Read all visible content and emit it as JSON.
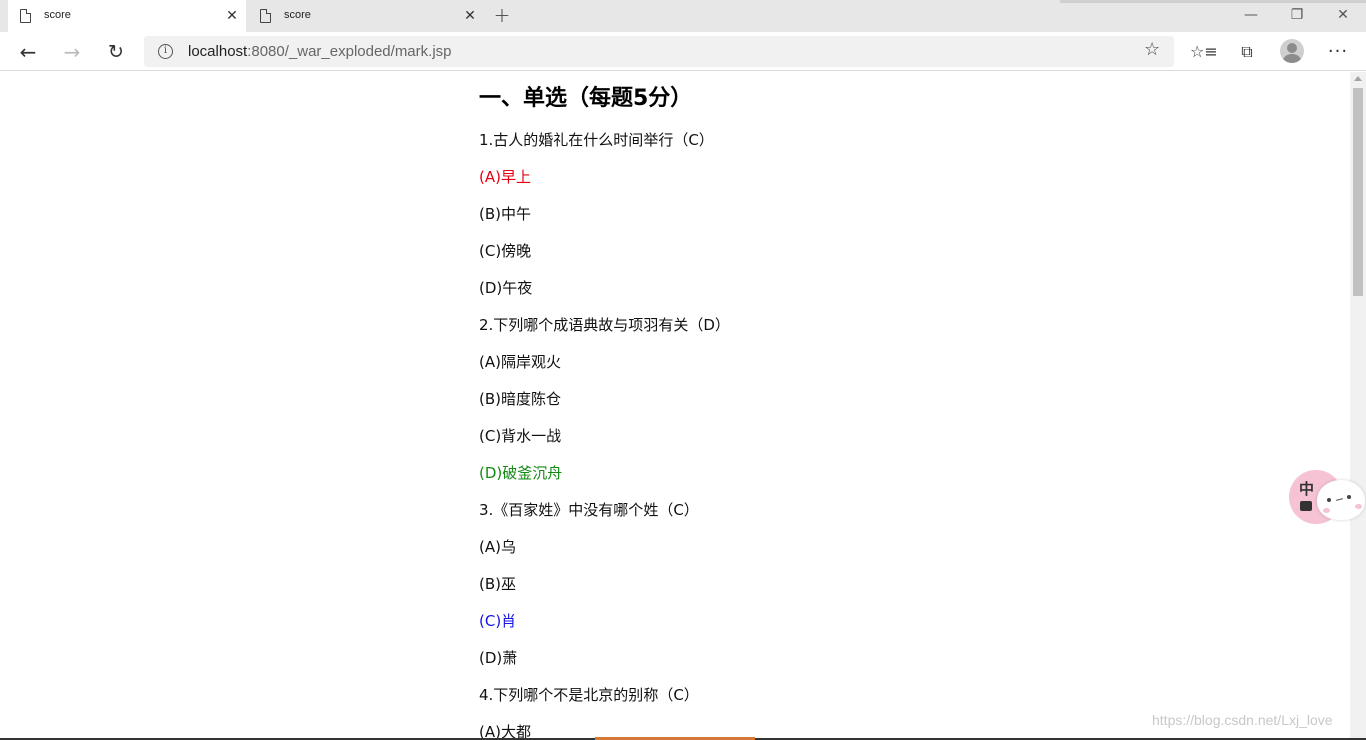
{
  "browser": {
    "tabs": [
      {
        "title": "score",
        "active": true,
        "close_glyph": "✕"
      },
      {
        "title": "score",
        "active": false,
        "close_glyph": "✕"
      }
    ],
    "new_tab_glyph": "+",
    "window_controls": {
      "minimize": "—",
      "maximize": "❐",
      "close": "✕"
    },
    "nav": {
      "back": "←",
      "forward": "→",
      "reload": "↻"
    },
    "address": {
      "info_glyph": "i",
      "host": "localhost",
      "path": ":8080/_war_exploded/mark.jsp"
    },
    "toolbar_icons": {
      "star": "☆",
      "favorites": "☆≡",
      "collections": "⧉",
      "more": "···"
    }
  },
  "page": {
    "section_title": "一、单选（每题5分）",
    "questions": [
      {
        "stem": "1.古人的婚礼在什么时间举行（C）",
        "options": [
          {
            "text": "(A)早上",
            "state": "wrong"
          },
          {
            "text": "(B)中午",
            "state": "normal"
          },
          {
            "text": "(C)傍晚",
            "state": "normal"
          },
          {
            "text": "(D)午夜",
            "state": "normal"
          }
        ]
      },
      {
        "stem": "2.下列哪个成语典故与项羽有关（D）",
        "options": [
          {
            "text": "(A)隔岸观火",
            "state": "normal"
          },
          {
            "text": "(B)暗度陈仓",
            "state": "normal"
          },
          {
            "text": "(C)背水一战",
            "state": "normal"
          },
          {
            "text": "(D)破釜沉舟",
            "state": "correct"
          }
        ]
      },
      {
        "stem": "3.《百家姓》中没有哪个姓（C）",
        "options": [
          {
            "text": "(A)乌",
            "state": "normal"
          },
          {
            "text": "(B)巫",
            "state": "normal"
          },
          {
            "text": "(C)肖",
            "state": "answer"
          },
          {
            "text": "(D)萧",
            "state": "normal"
          }
        ]
      },
      {
        "stem": "4.下列哪个不是北京的别称（C）",
        "options": [
          {
            "text": "(A)大都",
            "state": "normal"
          }
        ]
      }
    ],
    "colors": {
      "wrong": "#e60012",
      "correct": "#138a13",
      "answer": "#1414e6"
    }
  },
  "widget": {
    "char": "中"
  },
  "watermark": "https://blog.csdn.net/Lxj_love"
}
